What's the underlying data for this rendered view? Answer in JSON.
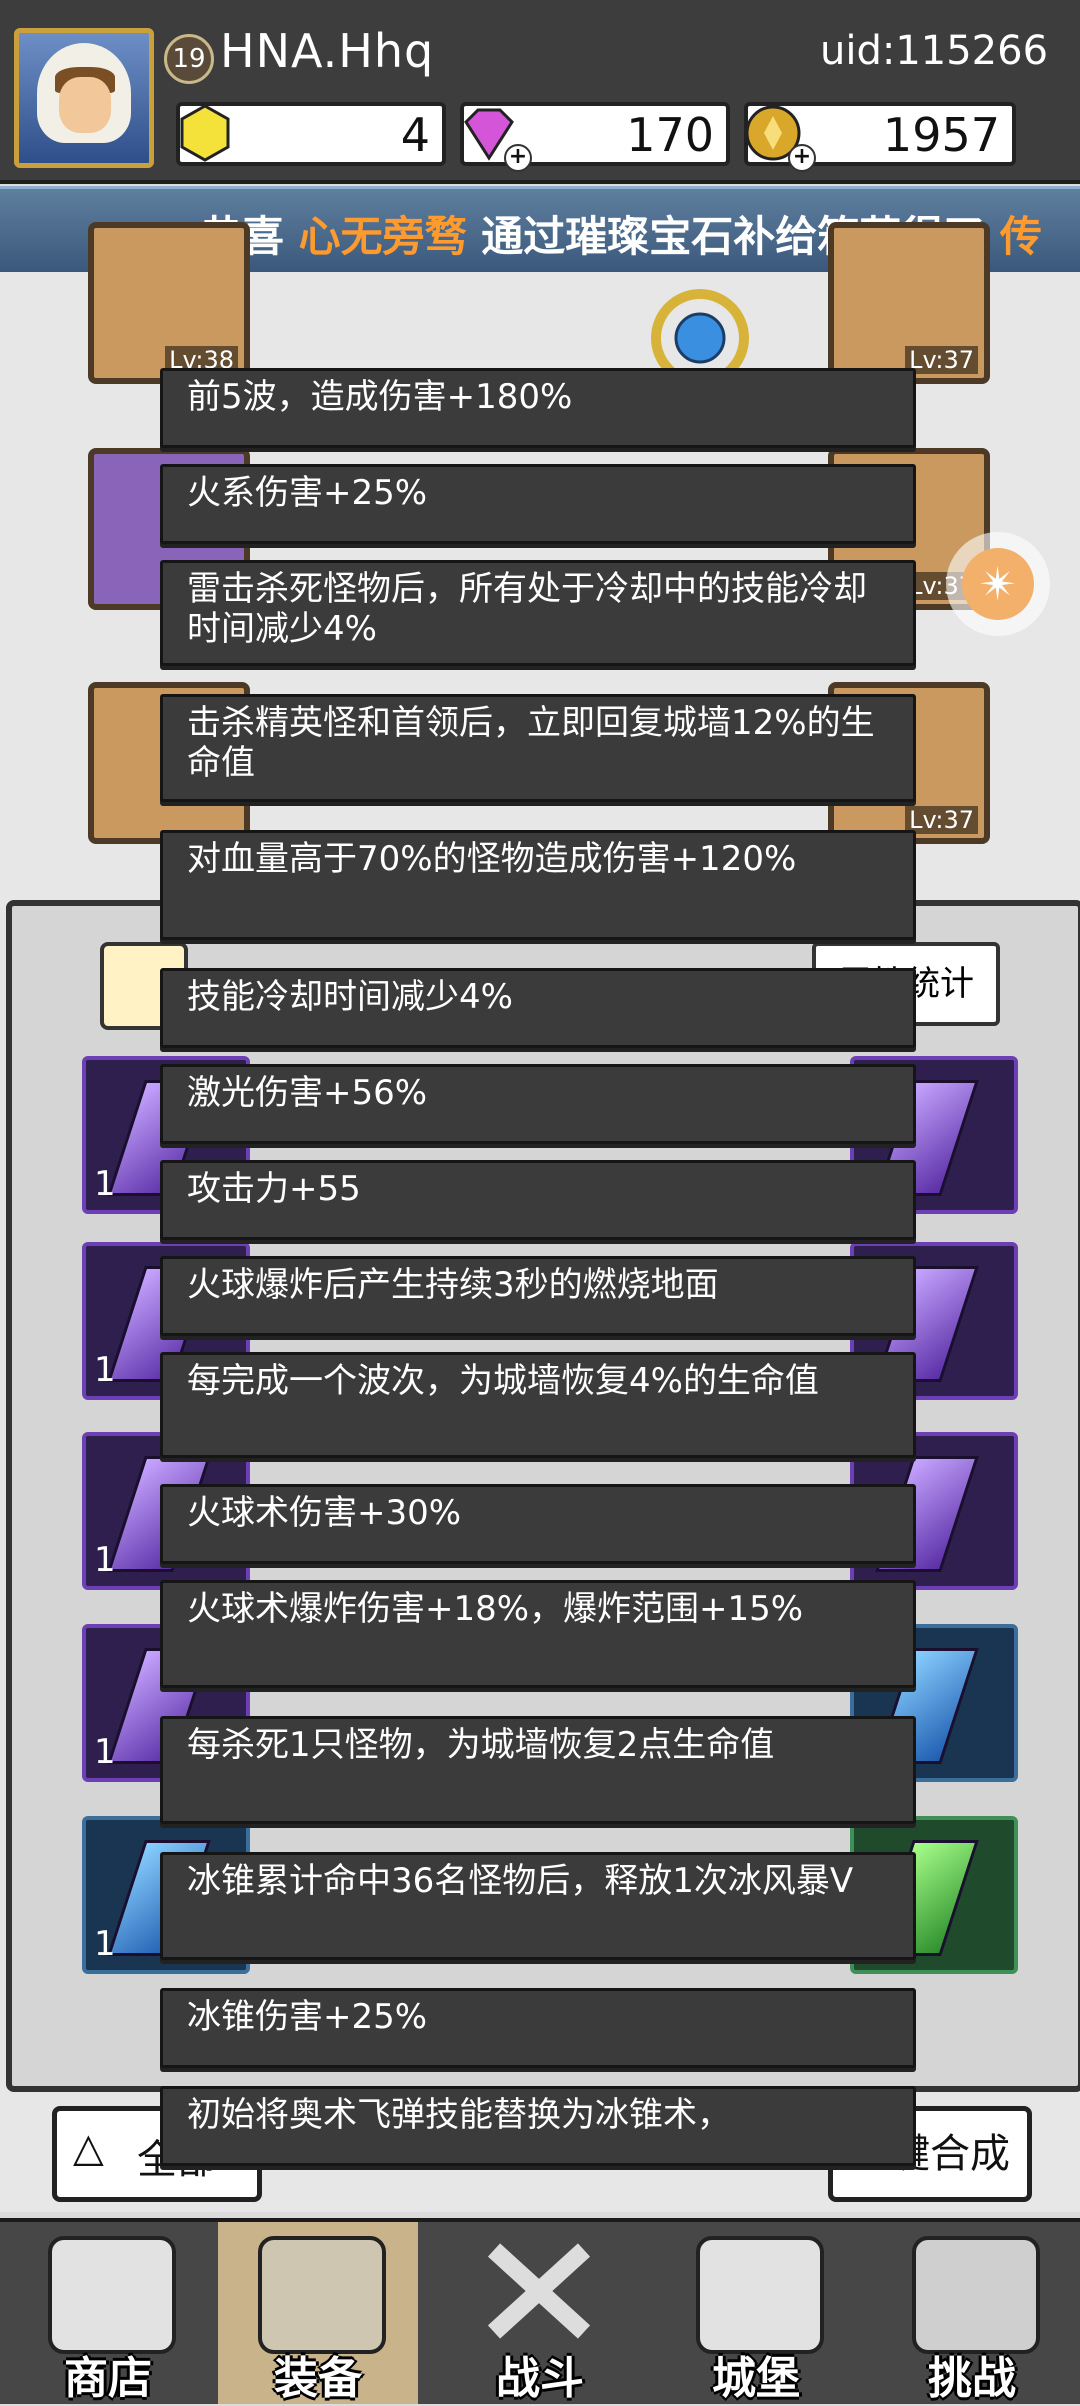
{
  "player": {
    "level": "19",
    "name": "HNA.Hhq",
    "uid": "uid:115266"
  },
  "resources": [
    {
      "icon": "gold-hex-icon",
      "value": "4"
    },
    {
      "icon": "purple-gem-icon",
      "value": "170"
    },
    {
      "icon": "coin-icon",
      "value": "1957"
    }
  ],
  "ticker": {
    "prefix": "恭喜",
    "name": "心无旁骛",
    "middle": "通过璀璨宝石补给箱获得了",
    "suffix": "传"
  },
  "equipment": {
    "levels": [
      "Lv:38",
      "Lv:37",
      "Lv:37",
      "Lv:37"
    ]
  },
  "panel": {
    "stats_button": "属性统计",
    "card_count": "1"
  },
  "actions": {
    "filter_label": "全部",
    "merge_label": "一键合成"
  },
  "tooltips": [
    "前5波，造成伤害+180%",
    "火系伤害+25%",
    "雷击杀死怪物后，所有处于冷却中的技能冷却时间减少4%",
    "击杀精英怪和首领后，立即回复城墙12%的生命值",
    "对血量高于70%的怪物造成伤害+120%",
    "技能冷却时间减少4%",
    "激光伤害+56%",
    "攻击力+55",
    "火球爆炸后产生持续3秒的燃烧地面",
    "每完成一个波次，为城墙恢复4%的生命值",
    "火球术伤害+30%",
    "火球术爆炸伤害+18%，爆炸范围+15%",
    "每杀死1只怪物，为城墙恢复2点生命值",
    "冰锥累计命中36名怪物后，释放1次冰风暴V",
    "冰锥伤害+25%",
    "初始将奥术飞弹技能替换为冰锥术，"
  ],
  "nav": [
    {
      "label": "商店",
      "icon": "shop-icon"
    },
    {
      "label": "装备",
      "icon": "backpack-icon"
    },
    {
      "label": "战斗",
      "icon": "crossed-swords-icon"
    },
    {
      "label": "城堡",
      "icon": "castle-icon"
    },
    {
      "label": "挑战",
      "icon": "challenge-shield-icon"
    }
  ],
  "colors": {
    "highlight": "#ff9a2e",
    "tooltip_bg": "#3b3b3b",
    "nav_active": "#c9b38a"
  }
}
